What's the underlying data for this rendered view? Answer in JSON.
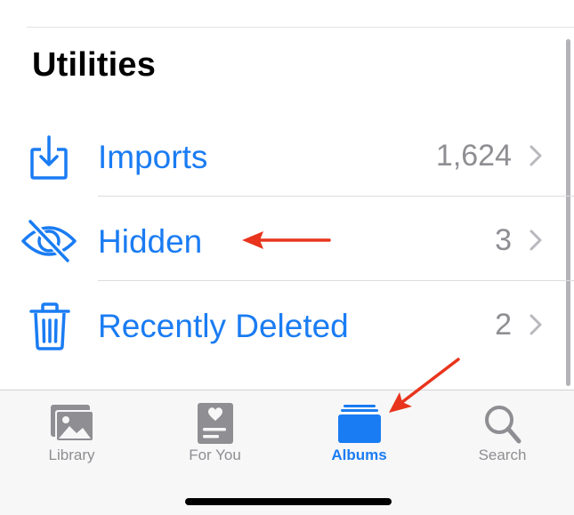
{
  "section": {
    "title": "Utilities"
  },
  "rows": [
    {
      "label": "Imports",
      "count": "1,624",
      "icon": "import-icon"
    },
    {
      "label": "Hidden",
      "count": "3",
      "icon": "eye-slash-icon"
    },
    {
      "label": "Recently Deleted",
      "count": "2",
      "icon": "trash-icon"
    }
  ],
  "tabs": [
    {
      "label": "Library",
      "icon": "photo-library-icon",
      "active": false
    },
    {
      "label": "For You",
      "icon": "for-you-icon",
      "active": false
    },
    {
      "label": "Albums",
      "icon": "albums-icon",
      "active": true
    },
    {
      "label": "Search",
      "icon": "search-icon",
      "active": false
    }
  ],
  "colors": {
    "accent": "#1a7cf3",
    "secondary": "#8e8e93",
    "annotation": "#e8341c",
    "tab_bar": "#f7f7f7"
  }
}
